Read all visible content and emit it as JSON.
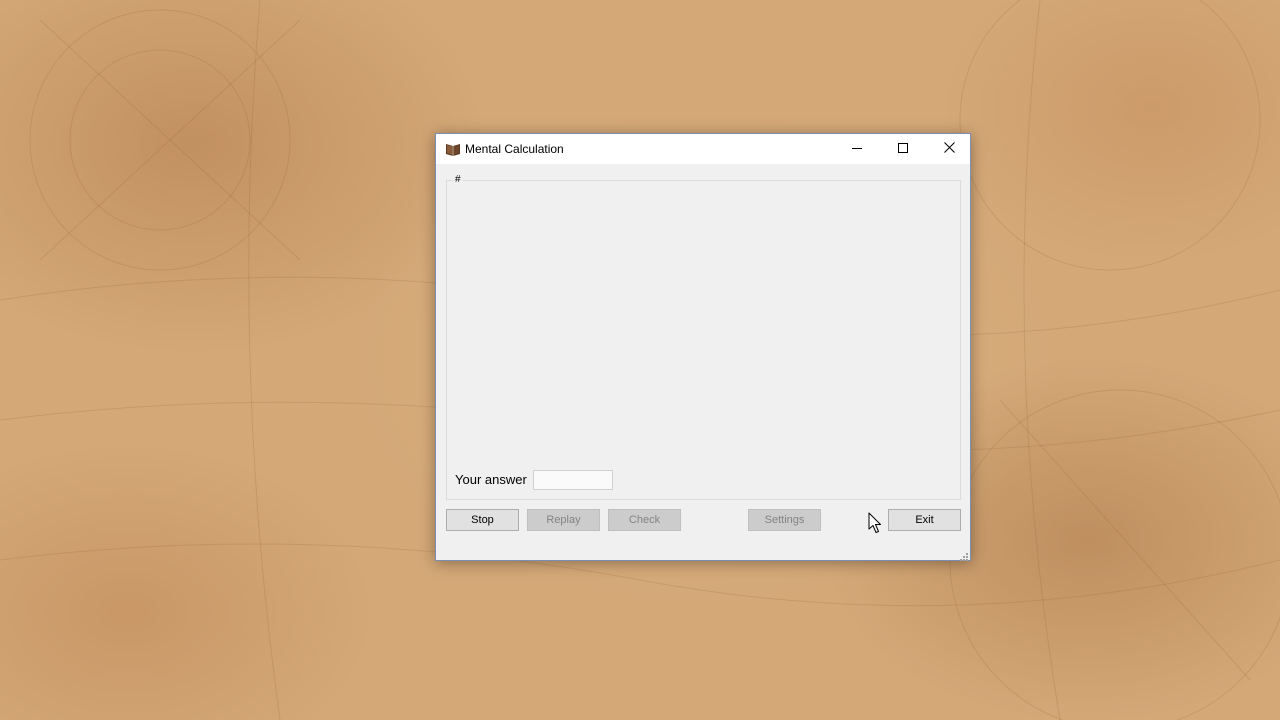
{
  "window": {
    "title": "Mental Calculation",
    "icon": "book-icon"
  },
  "title_controls": {
    "minimize_icon": "minimize-icon",
    "maximize_icon": "maximize-icon",
    "close_icon": "close-icon"
  },
  "group": {
    "label": "#"
  },
  "answer": {
    "label": "Your answer",
    "value": ""
  },
  "buttons": {
    "stop": "Stop",
    "replay": "Replay",
    "check": "Check",
    "settings": "Settings",
    "exit": "Exit"
  },
  "colors": {
    "desktop": "#d4a877",
    "window_bg": "#f0f0f0",
    "titlebar_bg": "#ffffff",
    "window_border": "#7a8fb0",
    "button_bg": "#e1e1e1",
    "button_disabled_text": "#838383"
  }
}
